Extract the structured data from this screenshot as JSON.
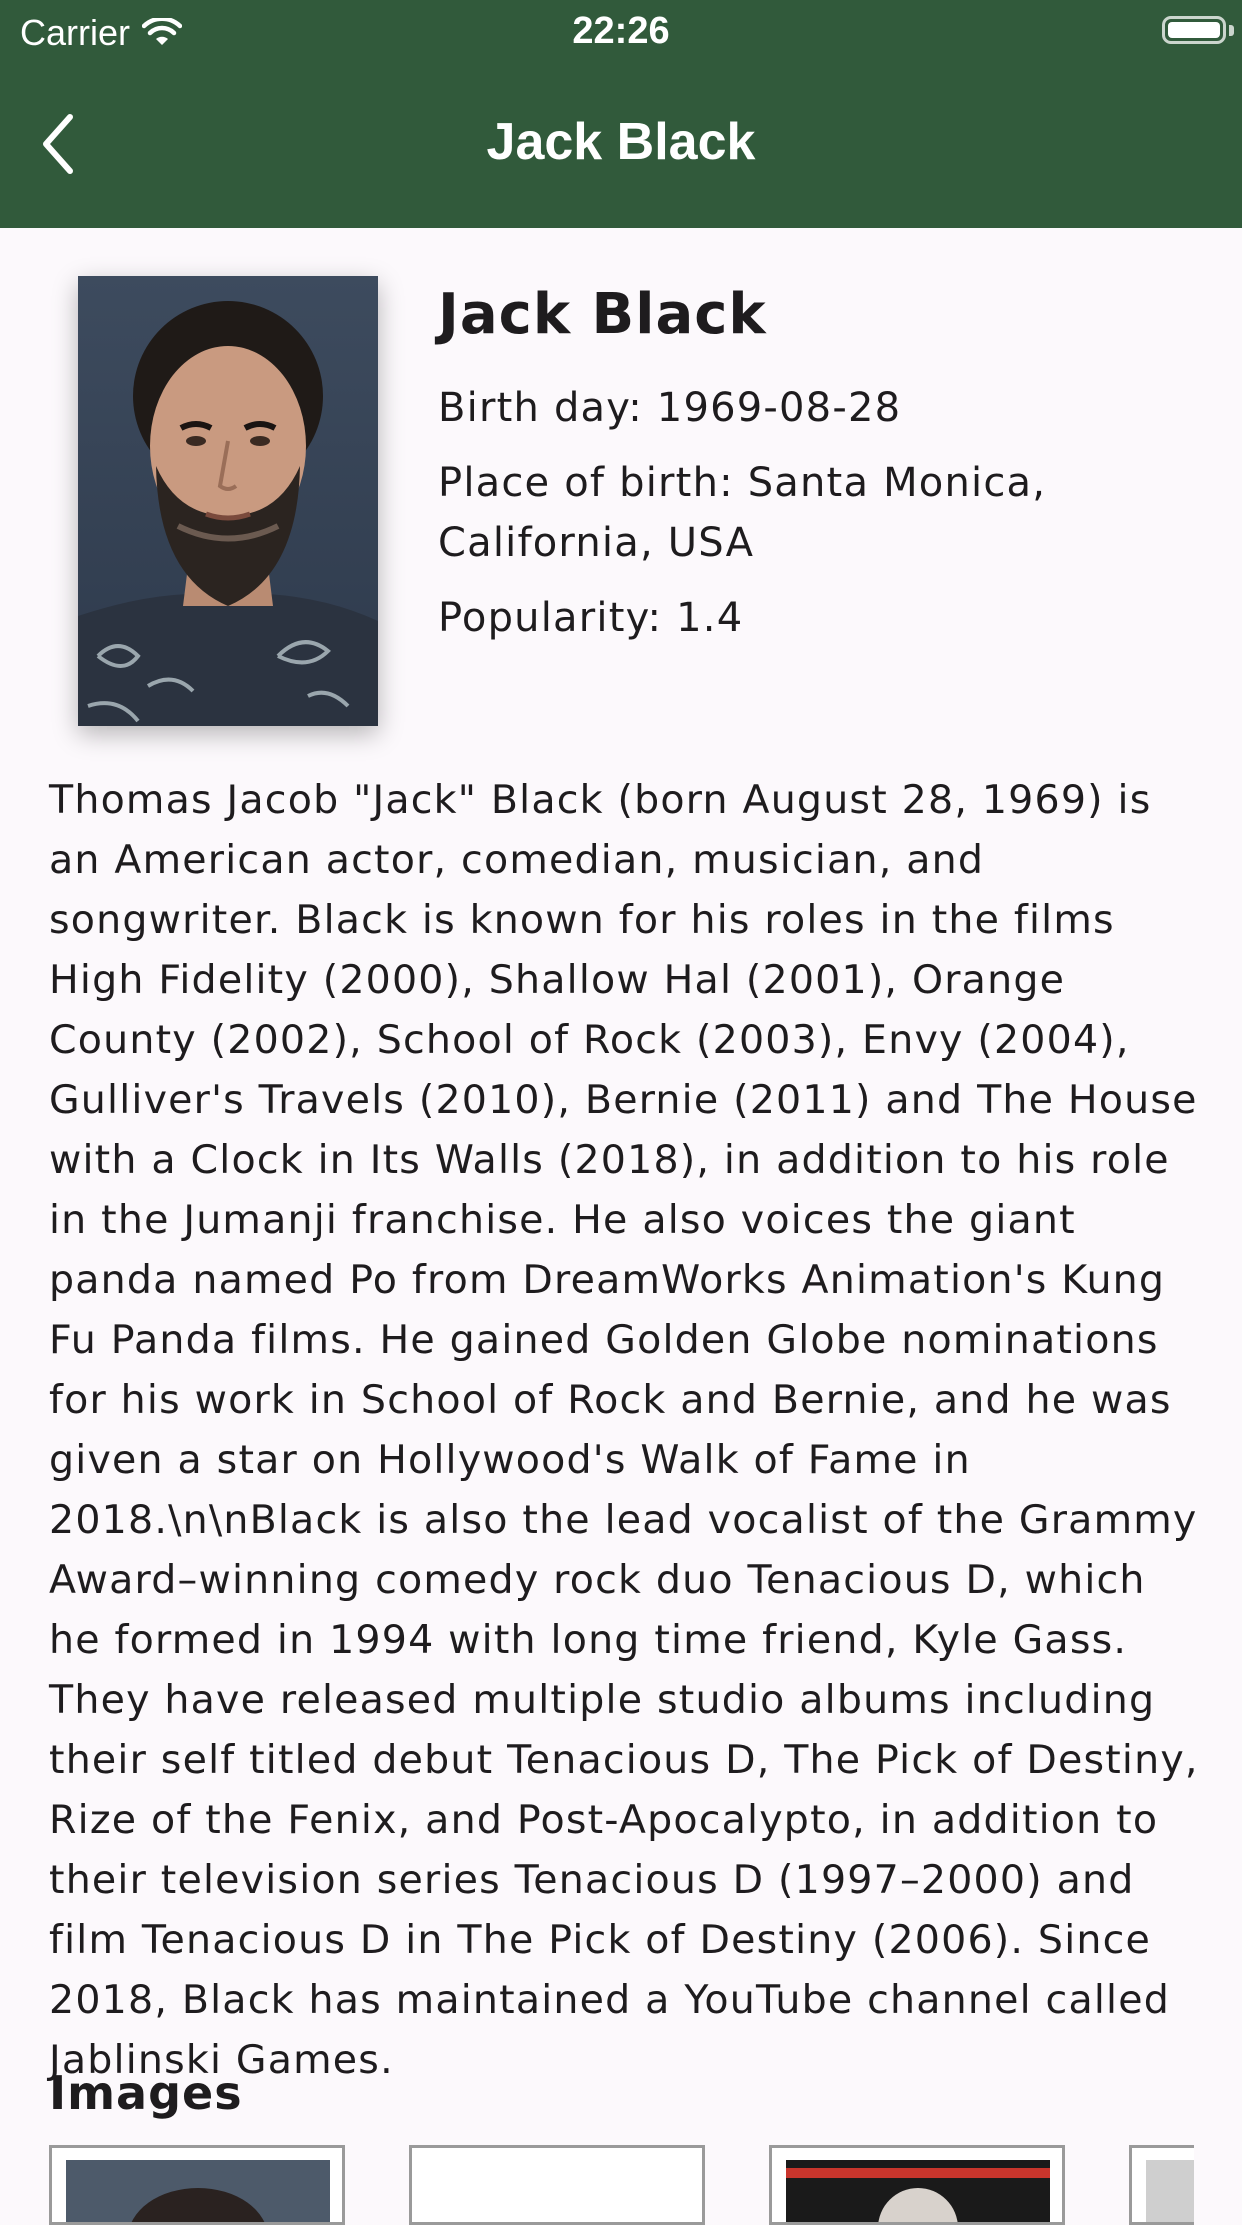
{
  "status_bar": {
    "carrier": "Carrier",
    "time": "22:26"
  },
  "nav": {
    "title": "Jack Black",
    "back_icon": "chevron-left-icon"
  },
  "person": {
    "name": "Jack Black",
    "birthday_line": "Birth day: 1969-08-28",
    "birthplace_line_1": "Place of birth: Santa Monica,",
    "birthplace_line_2": "California, USA",
    "popularity_line": "Popularity: 1.4",
    "bio": "Thomas Jacob \"Jack\" Black (born August 28, 1969) is an American actor, comedian, musician, and songwriter. Black is known for his roles in the films High Fidelity (2000), Shallow Hal (2001), Orange County (2002), School of Rock (2003), Envy (2004), Gulliver's Travels (2010), Bernie (2011) and The House with a Clock in Its Walls (2018), in addition to his role in the Jumanji franchise. He also voices the giant panda named Po from DreamWorks Animation's Kung Fu Panda films. He gained Golden Globe nominations for his work in School of Rock and Bernie, and he was given a star on Hollywood's Walk of Fame in 2018.\\n\\nBlack is also the lead vocalist of the Grammy Award–winning comedy rock duo Tenacious D, which he formed in 1994 with long time friend, Kyle Gass. They have released multiple studio albums including their self titled debut Tenacious D, The Pick of Destiny, Rize of the Fenix, and Post-Apocalypto, in addition to their television series Tenacious D (1997–2000) and film Tenacious D in The Pick of Destiny (2006). Since 2018, Black has maintained a YouTube channel called Jablinski Games."
  },
  "images_section": {
    "heading": "Images"
  },
  "colors": {
    "nav_background": "#315a3b",
    "page_background": "#fcf9fc",
    "text": "#1e1c1e"
  }
}
